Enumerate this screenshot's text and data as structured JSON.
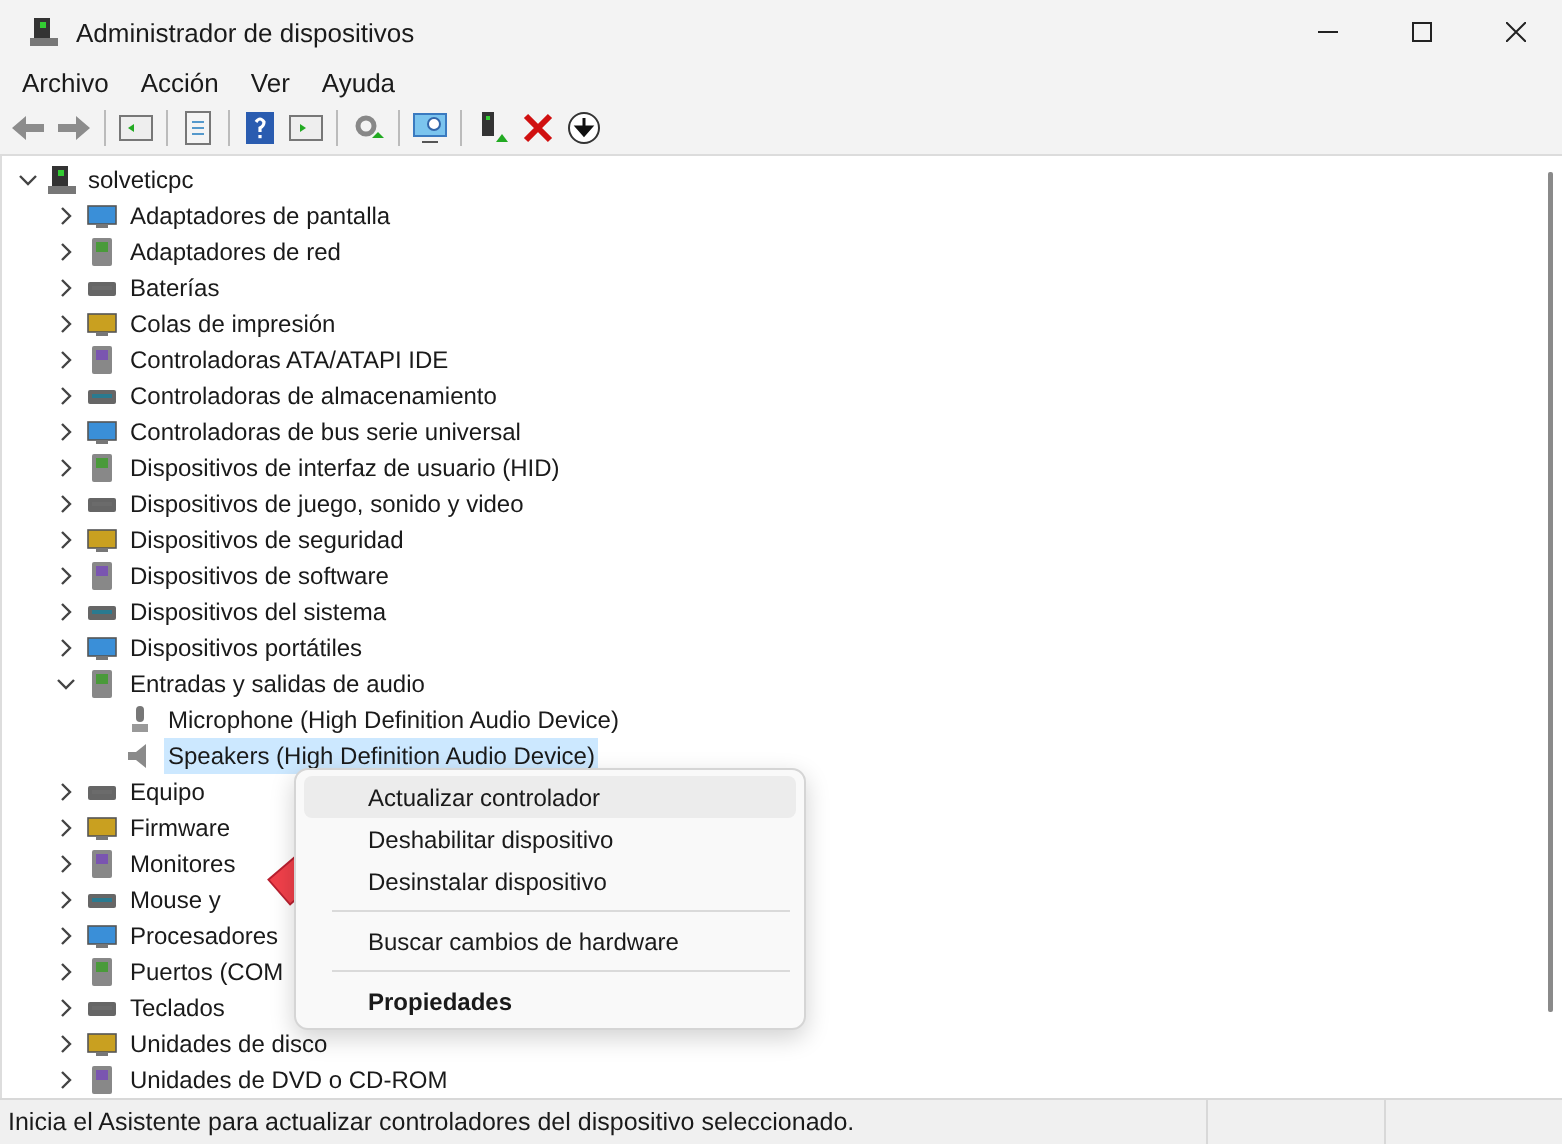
{
  "window": {
    "title": "Administrador de dispositivos"
  },
  "menu_bar": [
    "Archivo",
    "Acción",
    "Ver",
    "Ayuda"
  ],
  "tree": {
    "label": "solveticpc",
    "expanded": true,
    "selected": false,
    "children": [
      {
        "label": "Adaptadores de pantalla",
        "expanded": false,
        "selected": false
      },
      {
        "label": "Adaptadores de red",
        "expanded": false,
        "selected": false
      },
      {
        "label": "Baterías",
        "expanded": false,
        "selected": false
      },
      {
        "label": "Colas de impresión",
        "expanded": false,
        "selected": false
      },
      {
        "label": "Controladoras ATA/ATAPI IDE",
        "expanded": false,
        "selected": false
      },
      {
        "label": "Controladoras de almacenamiento",
        "expanded": false,
        "selected": false
      },
      {
        "label": "Controladoras de bus serie universal",
        "expanded": false,
        "selected": false
      },
      {
        "label": "Dispositivos de interfaz de usuario (HID)",
        "expanded": false,
        "selected": false
      },
      {
        "label": "Dispositivos de juego, sonido y video",
        "expanded": false,
        "selected": false
      },
      {
        "label": "Dispositivos de seguridad",
        "expanded": false,
        "selected": false
      },
      {
        "label": "Dispositivos de software",
        "expanded": false,
        "selected": false
      },
      {
        "label": "Dispositivos del sistema",
        "expanded": false,
        "selected": false
      },
      {
        "label": "Dispositivos portátiles",
        "expanded": false,
        "selected": false
      },
      {
        "label": "Entradas y salidas de audio",
        "expanded": true,
        "selected": false,
        "children": [
          {
            "label": "Microphone (High Definition Audio Device)",
            "selected": false
          },
          {
            "label": "Speakers (High Definition Audio Device)",
            "selected": true
          }
        ]
      },
      {
        "label": "Equipo",
        "expanded": false,
        "selected": false
      },
      {
        "label": "Firmware",
        "expanded": false,
        "selected": false
      },
      {
        "label": "Monitores",
        "expanded": false,
        "selected": false
      },
      {
        "label": "Mouse y",
        "expanded": false,
        "selected": false
      },
      {
        "label": "Procesadores",
        "expanded": false,
        "selected": false
      },
      {
        "label": "Puertos (COM",
        "expanded": false,
        "selected": false
      },
      {
        "label": "Teclados",
        "expanded": false,
        "selected": false
      },
      {
        "label": "Unidades de disco",
        "expanded": false,
        "selected": false
      },
      {
        "label": "Unidades de DVD o CD-ROM",
        "expanded": false,
        "selected": false
      }
    ]
  },
  "context_menu": [
    {
      "kind": "item",
      "label": "Actualizar controlador",
      "selected": true
    },
    {
      "kind": "item",
      "label": "Deshabilitar dispositivo",
      "selected": false
    },
    {
      "kind": "item",
      "label": "Desinstalar dispositivo",
      "selected": false
    },
    {
      "kind": "separator"
    },
    {
      "kind": "item",
      "label": "Buscar cambios de hardware",
      "selected": false
    },
    {
      "kind": "separator"
    },
    {
      "kind": "default",
      "label": "Propiedades",
      "selected": false
    }
  ],
  "status_bar": "Inicia el Asistente para actualizar controladores del dispositivo seleccionado."
}
